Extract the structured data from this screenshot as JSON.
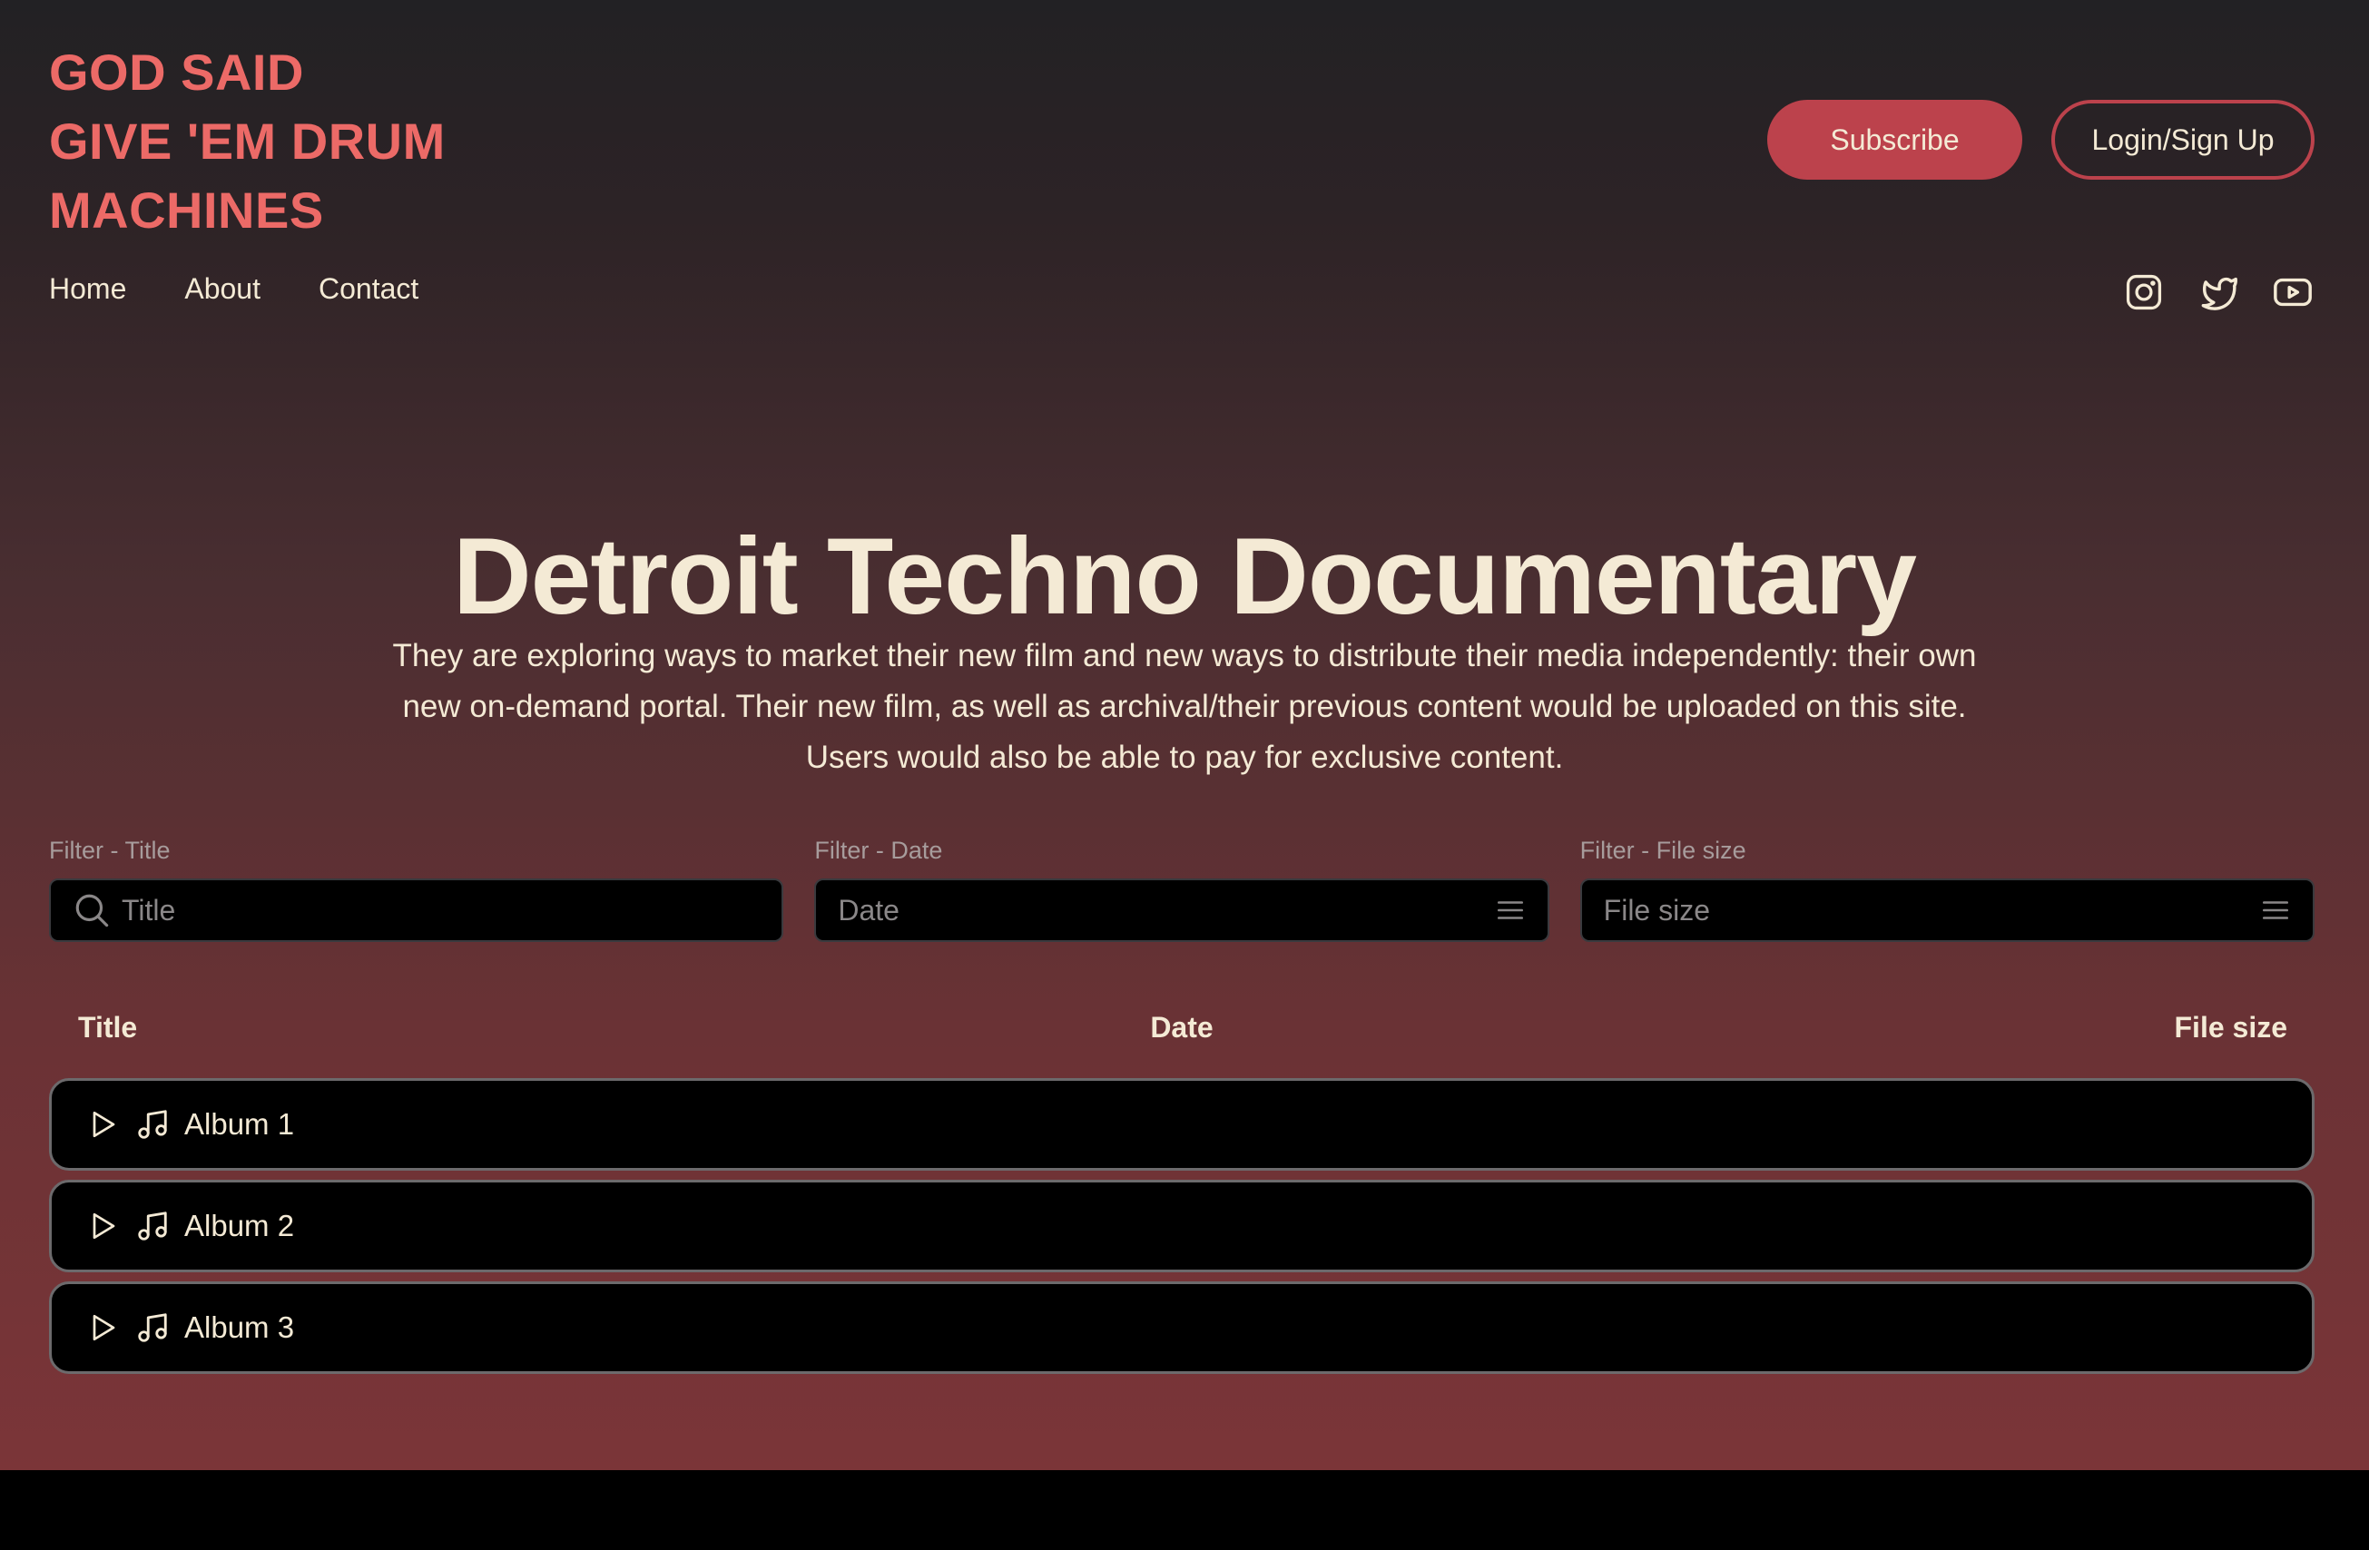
{
  "brand": {
    "logo_lines": [
      "GOD SAID",
      "GIVE 'EM DRUM",
      "MACHINES"
    ]
  },
  "header": {
    "subscribe_label": "Subscribe",
    "login_label": "Login/Sign Up"
  },
  "nav": {
    "items": [
      {
        "label": "Home"
      },
      {
        "label": "About"
      },
      {
        "label": "Contact"
      }
    ]
  },
  "social": {
    "icons": [
      "instagram-icon",
      "twitter-icon",
      "youtube-icon"
    ]
  },
  "hero": {
    "title": "Detroit Techno Documentary",
    "description": "They are exploring ways to market their new film and new ways to distribute their media independently: their own new on-demand portal. Their new film, as well as archival/their previous content would be uploaded on this site. Users would also be able to pay for exclusive content."
  },
  "filters": {
    "title": {
      "label": "Filter - Title",
      "placeholder": "Title",
      "value": ""
    },
    "date": {
      "label": "Filter - Date",
      "placeholder": "Date",
      "value": ""
    },
    "size": {
      "label": "Filter - File size",
      "placeholder": "File size",
      "value": ""
    }
  },
  "table": {
    "columns": [
      "Title",
      "Date",
      "File size"
    ],
    "rows": [
      {
        "title": "Album 1"
      },
      {
        "title": "Album 2"
      },
      {
        "title": "Album 3"
      }
    ]
  },
  "colors": {
    "accent": "#ec6a67",
    "button": "#bc424c",
    "text": "#f4ead5"
  }
}
